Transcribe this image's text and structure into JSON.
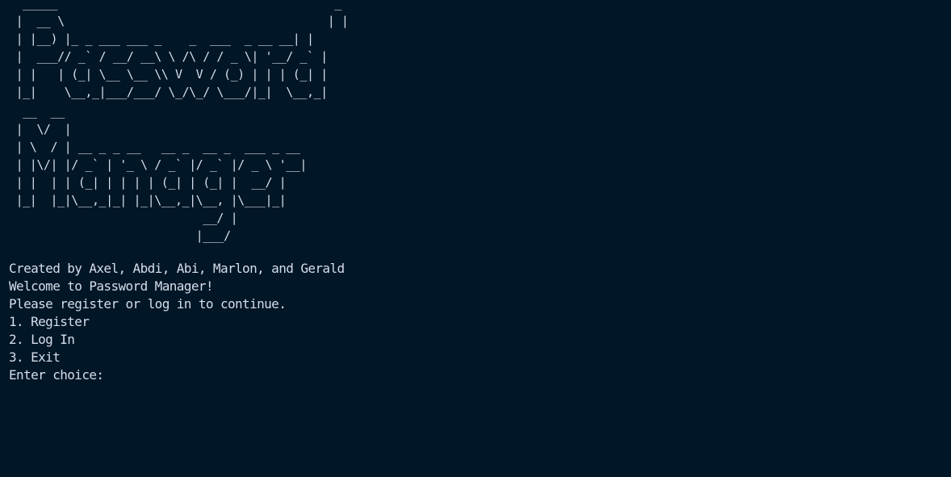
{
  "terminal": {
    "banner_password": "  _____                                        _\n |  __ \\                                      | |\n | |__) |_ _ ___ ___ _    _  ___  _ __ __| |\n |  ___// _` / __/ __\\ \\ /\\ / / _ \\| '__/ _` |\n | |   | (_| \\__ \\__ \\\\ V  V / (_) | | | (_| |\n |_|    \\__,_|___/___/ \\_/\\_/ \\___/|_|  \\__,_|",
    "banner_manager": "  __  __\n |  \\/  |\n | \\  / | __ _ _ __   __ _  __ _  ___ _ __\n | |\\/| |/ _` | '_ \\ / _` |/ _` |/ _ \\ '__|\n | |  | | (_| | | | | (_| | (_| |  __/ |\n |_|  |_|\\__,_|_| |_|\\__,_|\\__, |\\___|_|\n                            __/ |\n                           |___/",
    "credits": "Created by Axel, Abdi, Abi, Marlon, and Gerald",
    "welcome": "Welcome to Password Manager!",
    "instruction": "Please register or log in to continue.",
    "options": [
      "1. Register",
      "2. Log In",
      "3. Exit"
    ],
    "prompt": "Enter choice:",
    "input_value": ""
  }
}
